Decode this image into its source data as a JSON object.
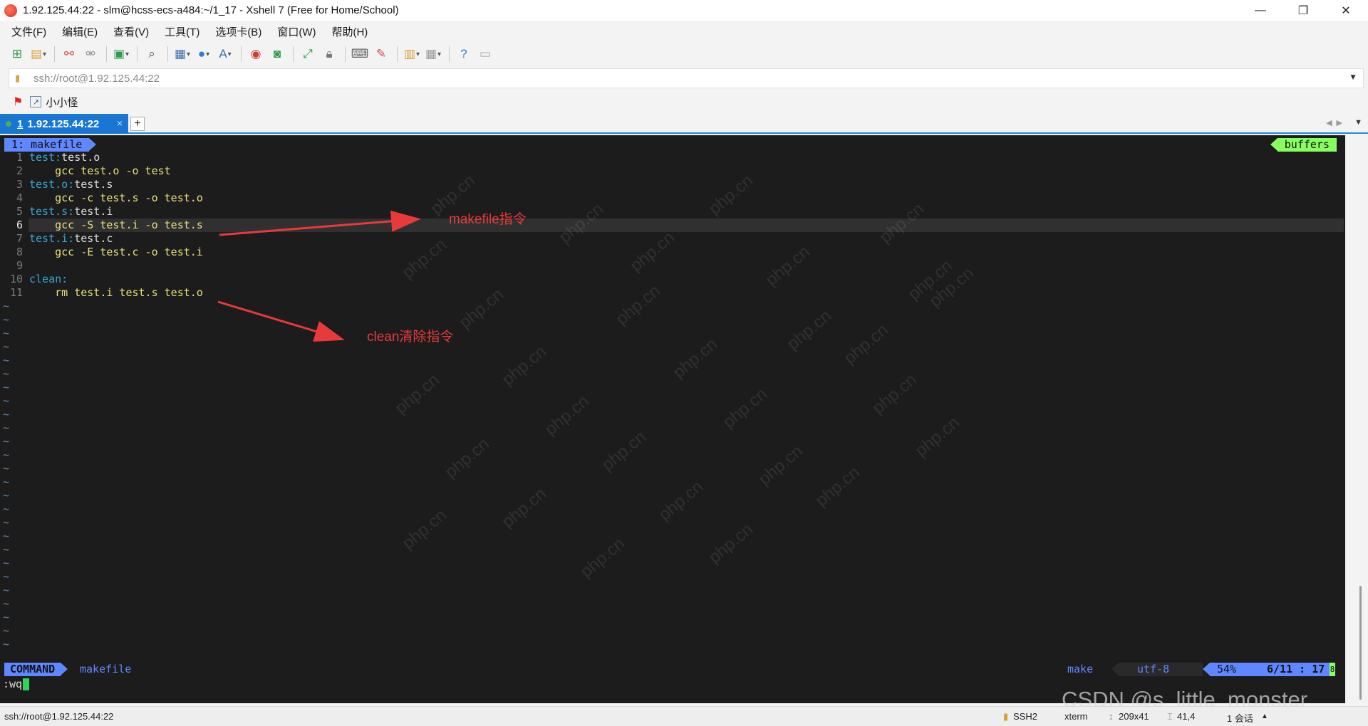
{
  "window": {
    "title": "1.92.125.44:22 - slm@hcss-ecs-a484:~/1_17 - Xshell 7 (Free for Home/School)",
    "minimize": "—",
    "restore": "❐",
    "close": "✕"
  },
  "menu": [
    "文件(F)",
    "编辑(E)",
    "查看(V)",
    "工具(T)",
    "选项卡(B)",
    "窗口(W)",
    "帮助(H)"
  ],
  "address": {
    "value": "ssh://root@1.92.125.44:22"
  },
  "links": {
    "item": "小小怪"
  },
  "tabs": [
    {
      "number": "1",
      "label": "1.92.125.44:22",
      "close": "×"
    }
  ],
  "vim": {
    "buffer_tab": "1: makefile",
    "buffers_label": "buffers",
    "lines": [
      {
        "n": "1",
        "target": "test:",
        "rest": "test.o",
        "kind": "target"
      },
      {
        "n": "2",
        "target": "",
        "rest": "    gcc test.o -o test",
        "kind": "cmd"
      },
      {
        "n": "3",
        "target": "test.o:",
        "rest": "test.s",
        "kind": "target"
      },
      {
        "n": "4",
        "target": "",
        "rest": "    gcc -c test.s -o test.o",
        "kind": "cmd"
      },
      {
        "n": "5",
        "target": "test.s:",
        "rest": "test.i",
        "kind": "target"
      },
      {
        "n": "6",
        "target": "",
        "rest": "    gcc -S test.i -o test.s",
        "kind": "cmd"
      },
      {
        "n": "7",
        "target": "test.i:",
        "rest": "test.c",
        "kind": "target"
      },
      {
        "n": "8",
        "target": "",
        "rest": "    gcc -E test.c -o test.i",
        "kind": "cmd"
      },
      {
        "n": "9",
        "target": "",
        "rest": "",
        "kind": "cmd"
      },
      {
        "n": "10",
        "target": "clean:",
        "rest": "",
        "kind": "target"
      },
      {
        "n": "11",
        "target": "",
        "rest": "    rm test.i test.s test.o",
        "kind": "cmd"
      }
    ],
    "current_line": "6",
    "tilde": "~",
    "status": {
      "mode": "COMMAND",
      "filename": "makefile",
      "filetype": "make",
      "encoding": "utf-8",
      "percent": "54%",
      "position": "6/11 :  17",
      "end_marker": "8"
    },
    "command": ":wq"
  },
  "annotations": {
    "makefile": "makefile指令",
    "clean": "clean清除指令"
  },
  "watermark": "php.cn",
  "csdn": "CSDN @s_little_monster",
  "statusbar": {
    "connection": "ssh://root@1.92.125.44:22",
    "protocol": "SSH2",
    "terminal": "xterm",
    "size": "209x41",
    "cursor": "41,4",
    "sessions": "1 会话"
  },
  "colors": {
    "accent": "#1976d2",
    "vim_blue": "#5f87ff",
    "vim_green": "#87ff5f",
    "annotation_red": "#e83a3a"
  }
}
